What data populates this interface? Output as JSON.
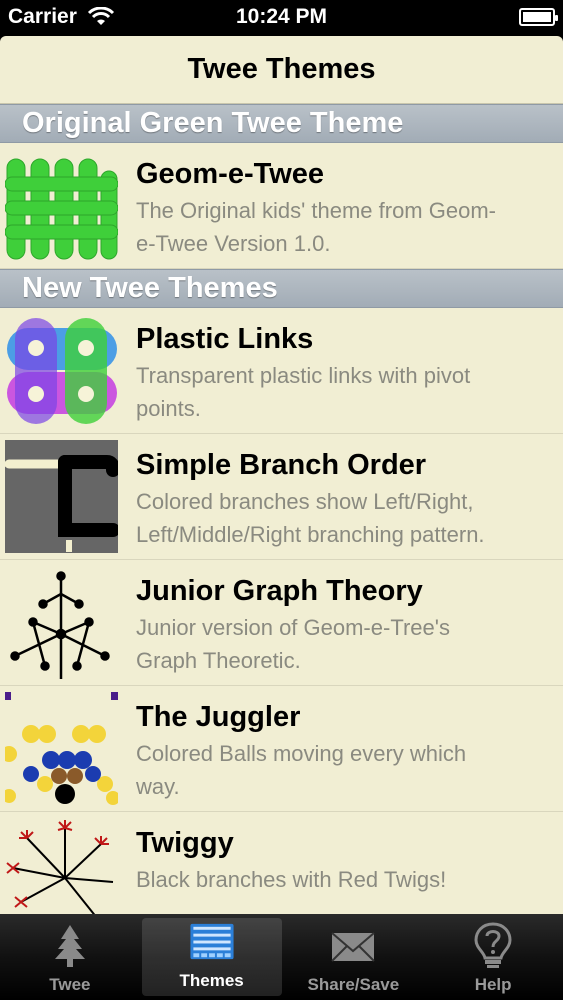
{
  "status_bar": {
    "carrier": "Carrier",
    "time": "10:24 PM"
  },
  "nav": {
    "title": "Twee Themes"
  },
  "sections": [
    {
      "header": "Original Green Twee Theme",
      "rows": [
        {
          "title": "Geom-e-Twee",
          "desc_line1": "The Original kids' theme from Geom-",
          "desc_line2": "e-Twee Version 1.0."
        }
      ]
    },
    {
      "header": "New Twee Themes",
      "rows": [
        {
          "title": "Plastic Links",
          "desc_line1": "Transparent plastic links with pivot",
          "desc_line2": "points."
        },
        {
          "title": "Simple Branch Order",
          "desc_line1": "Colored branches show Left/Right,",
          "desc_line2": "Left/Middle/Right branching pattern."
        },
        {
          "title": "Junior Graph Theory",
          "desc_line1": "Junior version of Geom-e-Tree's",
          "desc_line2": "Graph Theoretic."
        },
        {
          "title": "The Juggler",
          "desc_line1": "Colored Balls moving every which",
          "desc_line2": "way."
        },
        {
          "title": "Twiggy",
          "desc_line1": "Black branches with Red Twigs!",
          "desc_line2": ""
        }
      ]
    }
  ],
  "tabs": [
    {
      "label": "Twee",
      "icon": "tree-icon",
      "selected": false
    },
    {
      "label": "Themes",
      "icon": "themes-icon",
      "selected": true
    },
    {
      "label": "Share/Save",
      "icon": "envelope-icon",
      "selected": false
    },
    {
      "label": "Help",
      "icon": "lightbulb-question-icon",
      "selected": false
    }
  ],
  "colors": {
    "background": "#f1eed3",
    "section_header": "#a8b2bb",
    "desc_text": "#8a8a80",
    "green": "#3fcf3a"
  }
}
